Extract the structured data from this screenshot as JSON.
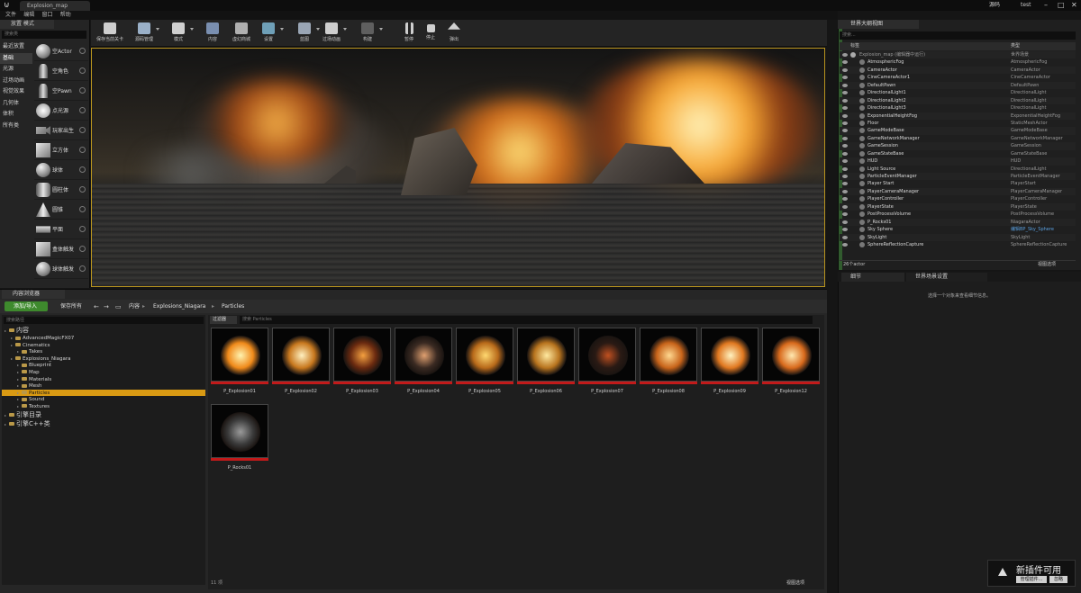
{
  "window": {
    "tab_title": "Explosion_map",
    "top_right": {
      "source_control": "源码",
      "project": "test"
    }
  },
  "menu": [
    "文件",
    "编辑",
    "窗口",
    "帮助"
  ],
  "modes": {
    "tab_label": "放置 模式",
    "search_placeholder": "搜索类",
    "categories": [
      "最近放置",
      "基础",
      "光源",
      "过场动画",
      "视觉效果",
      "几何体",
      "体积",
      "所有类"
    ],
    "active_category": 1,
    "items": [
      {
        "label": "空Actor",
        "icon": "sphere-icon"
      },
      {
        "label": "空角色",
        "icon": "figure-icon"
      },
      {
        "label": "空Pawn",
        "icon": "figure-icon"
      },
      {
        "label": "点光源",
        "icon": "bulb-icon"
      },
      {
        "label": "玩家出生",
        "icon": "camera-icon"
      },
      {
        "label": "立方体",
        "icon": "cube-icon"
      },
      {
        "label": "球体",
        "icon": "sphere-icon"
      },
      {
        "label": "圆柱体",
        "icon": "cylinder-icon"
      },
      {
        "label": "圆锥",
        "icon": "cone-icon"
      },
      {
        "label": "平面",
        "icon": "plane-icon"
      },
      {
        "label": "盒体触发",
        "icon": "cube-icon"
      },
      {
        "label": "球体触发",
        "icon": "sphere-icon"
      }
    ]
  },
  "toolbar": {
    "buttons": [
      {
        "label": "保存当前关卡",
        "icon": "save-icon",
        "color": "#cfcfcf"
      },
      {
        "label": "源码管理",
        "icon": "source-control-icon",
        "color": "#9ab0c8"
      },
      {
        "label": "模式",
        "icon": "modes-icon",
        "color": "#d0d0d0"
      },
      {
        "label": "内容",
        "icon": "content-icon",
        "color": "#7a8fb0"
      },
      {
        "label": "虚幻商城",
        "icon": "marketplace-icon",
        "color": "#b0b0b0"
      },
      {
        "label": "设置",
        "icon": "settings-icon",
        "color": "#6fa0b8"
      },
      {
        "label": "蓝图",
        "icon": "blueprint-icon",
        "color": "#9aa6b5"
      },
      {
        "label": "过场动画",
        "icon": "cinematics-icon",
        "color": "#cfcfcf"
      },
      {
        "label": "构建",
        "icon": "build-icon",
        "color": "#5f5f5f"
      },
      {
        "label": "暂停",
        "icon": "pause-icon",
        "color": "#cfcfcf"
      },
      {
        "label": "停止",
        "icon": "stop-icon",
        "color": "#cfcfcf"
      },
      {
        "label": "弹出",
        "icon": "eject-icon",
        "color": "#cfcfcf"
      }
    ]
  },
  "outliner": {
    "tab_label": "世界大纲视图",
    "search_placeholder": "搜索...",
    "col_label": "标签",
    "col_type": "类型",
    "rows": [
      {
        "name": "Explosion_map (编辑器中运行)",
        "type": "世界场景"
      },
      {
        "name": "AtmosphericFog",
        "type": "AtmosphericFog"
      },
      {
        "name": "CameraActor",
        "type": "CameraActor"
      },
      {
        "name": "CineCameraActor1",
        "type": "CineCameraActor"
      },
      {
        "name": "DefaultPawn",
        "type": "DefaultPawn"
      },
      {
        "name": "DirectionalLight1",
        "type": "DirectionalLight"
      },
      {
        "name": "DirectionalLight2",
        "type": "DirectionalLight"
      },
      {
        "name": "DirectionalLight3",
        "type": "DirectionalLight"
      },
      {
        "name": "ExponentialHeightFog",
        "type": "ExponentialHeightFog"
      },
      {
        "name": "Floor",
        "type": "StaticMeshActor"
      },
      {
        "name": "GameModeBase",
        "type": "GameModeBase"
      },
      {
        "name": "GameNetworkManager",
        "type": "GameNetworkManager"
      },
      {
        "name": "GameSession",
        "type": "GameSession"
      },
      {
        "name": "GameStateBase",
        "type": "GameStateBase"
      },
      {
        "name": "HUD",
        "type": "HUD"
      },
      {
        "name": "Light Source",
        "type": "DirectionalLight"
      },
      {
        "name": "ParticleEventManager",
        "type": "ParticleEventManager"
      },
      {
        "name": "Player Start",
        "type": "PlayerStart"
      },
      {
        "name": "PlayerCameraManager",
        "type": "PlayerCameraManager"
      },
      {
        "name": "PlayerController",
        "type": "PlayerController"
      },
      {
        "name": "PlayerState",
        "type": "PlayerState"
      },
      {
        "name": "PostProcessVolume",
        "type": "PostProcessVolume"
      },
      {
        "name": "P_Rocks01",
        "type": "NiagaraActor"
      },
      {
        "name": "Sky Sphere",
        "type": "编辑BP_Sky_Sphere",
        "link": true
      },
      {
        "name": "SkyLight",
        "type": "SkyLight"
      },
      {
        "name": "SphereReflectionCapture",
        "type": "SphereReflectionCapture"
      }
    ],
    "footer_count": "26个actor",
    "footer_view": "视图选项"
  },
  "details": {
    "tabs": [
      "细节",
      "世界场景设置"
    ],
    "empty_message": "选择一个对象来查看细节信息。"
  },
  "content_browser": {
    "tab_label": "内容浏览器",
    "add_label": "添加/导入",
    "save_label": "保存所有",
    "breadcrumbs": [
      "内容",
      "Explosions_Niagara",
      "Particles"
    ],
    "tree_search": "搜索路径",
    "filter_label": "过滤器",
    "search_placeholder": "搜索 Particles",
    "tree": [
      {
        "label": "内容",
        "depth": 0,
        "big": true
      },
      {
        "label": "AdvancedMagicFX07",
        "depth": 1
      },
      {
        "label": "Cinematics",
        "depth": 1
      },
      {
        "label": "Takes",
        "depth": 2
      },
      {
        "label": "Explosions_Niagara",
        "depth": 1
      },
      {
        "label": "Blueprint",
        "depth": 2
      },
      {
        "label": "Map",
        "depth": 2
      },
      {
        "label": "Materials",
        "depth": 2
      },
      {
        "label": "Mesh",
        "depth": 2
      },
      {
        "label": "Particles",
        "depth": 2,
        "selected": true
      },
      {
        "label": "Sound",
        "depth": 2
      },
      {
        "label": "Textures",
        "depth": 2
      },
      {
        "label": "引擎目录",
        "depth": 0,
        "big": true
      },
      {
        "label": "引擎C++类",
        "depth": 0,
        "big": true
      }
    ],
    "assets": [
      "P_Explosion01",
      "P_Explosion02",
      "P_Explosion03",
      "P_Explosion04",
      "P_Explosion05",
      "P_Explosion06",
      "P_Explosion07",
      "P_Explosion08",
      "P_Explosion09",
      "P_Explosion12",
      "P_Rocks01"
    ],
    "item_count": "11 项",
    "view_options": "视图选项"
  },
  "notification": {
    "title": "新插件可用",
    "manage_label": "管理插件...",
    "dismiss_label": "忽略"
  }
}
